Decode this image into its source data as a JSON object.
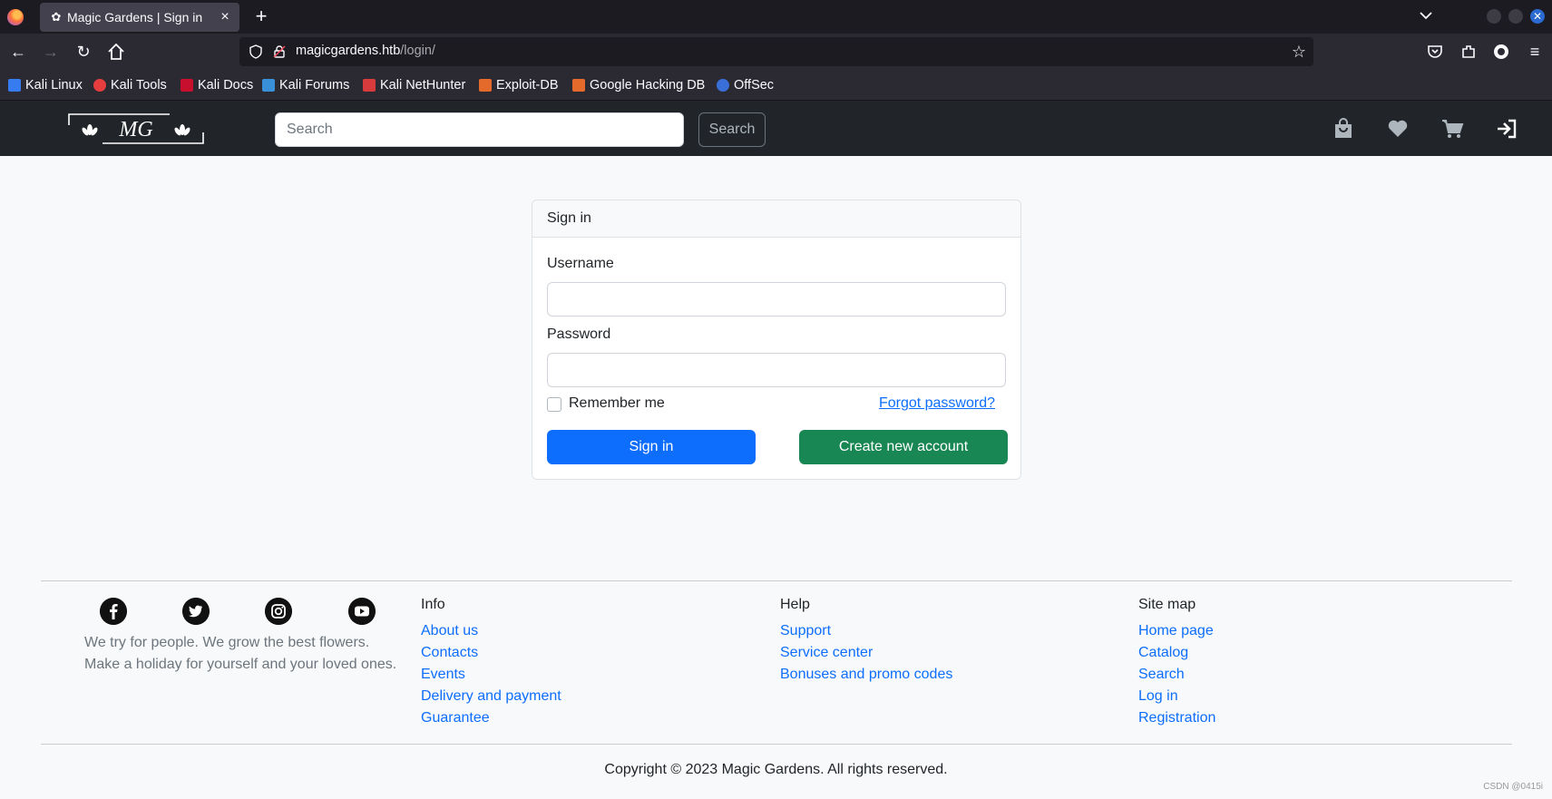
{
  "browser": {
    "tab_title": "Magic Gardens | Sign in",
    "url_host": "magicgardens.htb",
    "url_path": "/login/",
    "bookmarks": [
      "Kali Linux",
      "Kali Tools",
      "Kali Docs",
      "Kali Forums",
      "Kali NetHunter",
      "Exploit-DB",
      "Google Hacking DB",
      "OffSec"
    ]
  },
  "header": {
    "logo_text": "MG",
    "search_placeholder": "Search",
    "search_button": "Search",
    "icons": [
      "bag-icon",
      "heart-icon",
      "cart-icon",
      "sign-in-icon"
    ]
  },
  "signin": {
    "title": "Sign in",
    "username_label": "Username",
    "password_label": "Password",
    "remember_label": "Remember me",
    "forgot_link": "Forgot password?",
    "submit_button": "Sign in",
    "create_button": "Create new account"
  },
  "footer": {
    "social": [
      "facebook-icon",
      "twitter-icon",
      "instagram-icon",
      "youtube-icon"
    ],
    "tagline_1": "We try for people. We grow the best flowers.",
    "tagline_2": "Make a holiday for yourself and your loved ones.",
    "columns": [
      {
        "title": "Info",
        "links": [
          "About us",
          "Contacts",
          "Events",
          "Delivery and payment",
          "Guarantee"
        ]
      },
      {
        "title": "Help",
        "links": [
          "Support",
          "Service center",
          "Bonuses and promo codes"
        ]
      },
      {
        "title": "Site map",
        "links": [
          "Home page",
          "Catalog",
          "Search",
          "Log in",
          "Registration"
        ]
      }
    ],
    "copyright": "Copyright © 2023 Magic Gardens. All rights reserved."
  },
  "watermark": "CSDN @0415i",
  "colors": {
    "primary": "#0d6efd",
    "success": "#198754",
    "header_bg": "#212529"
  }
}
